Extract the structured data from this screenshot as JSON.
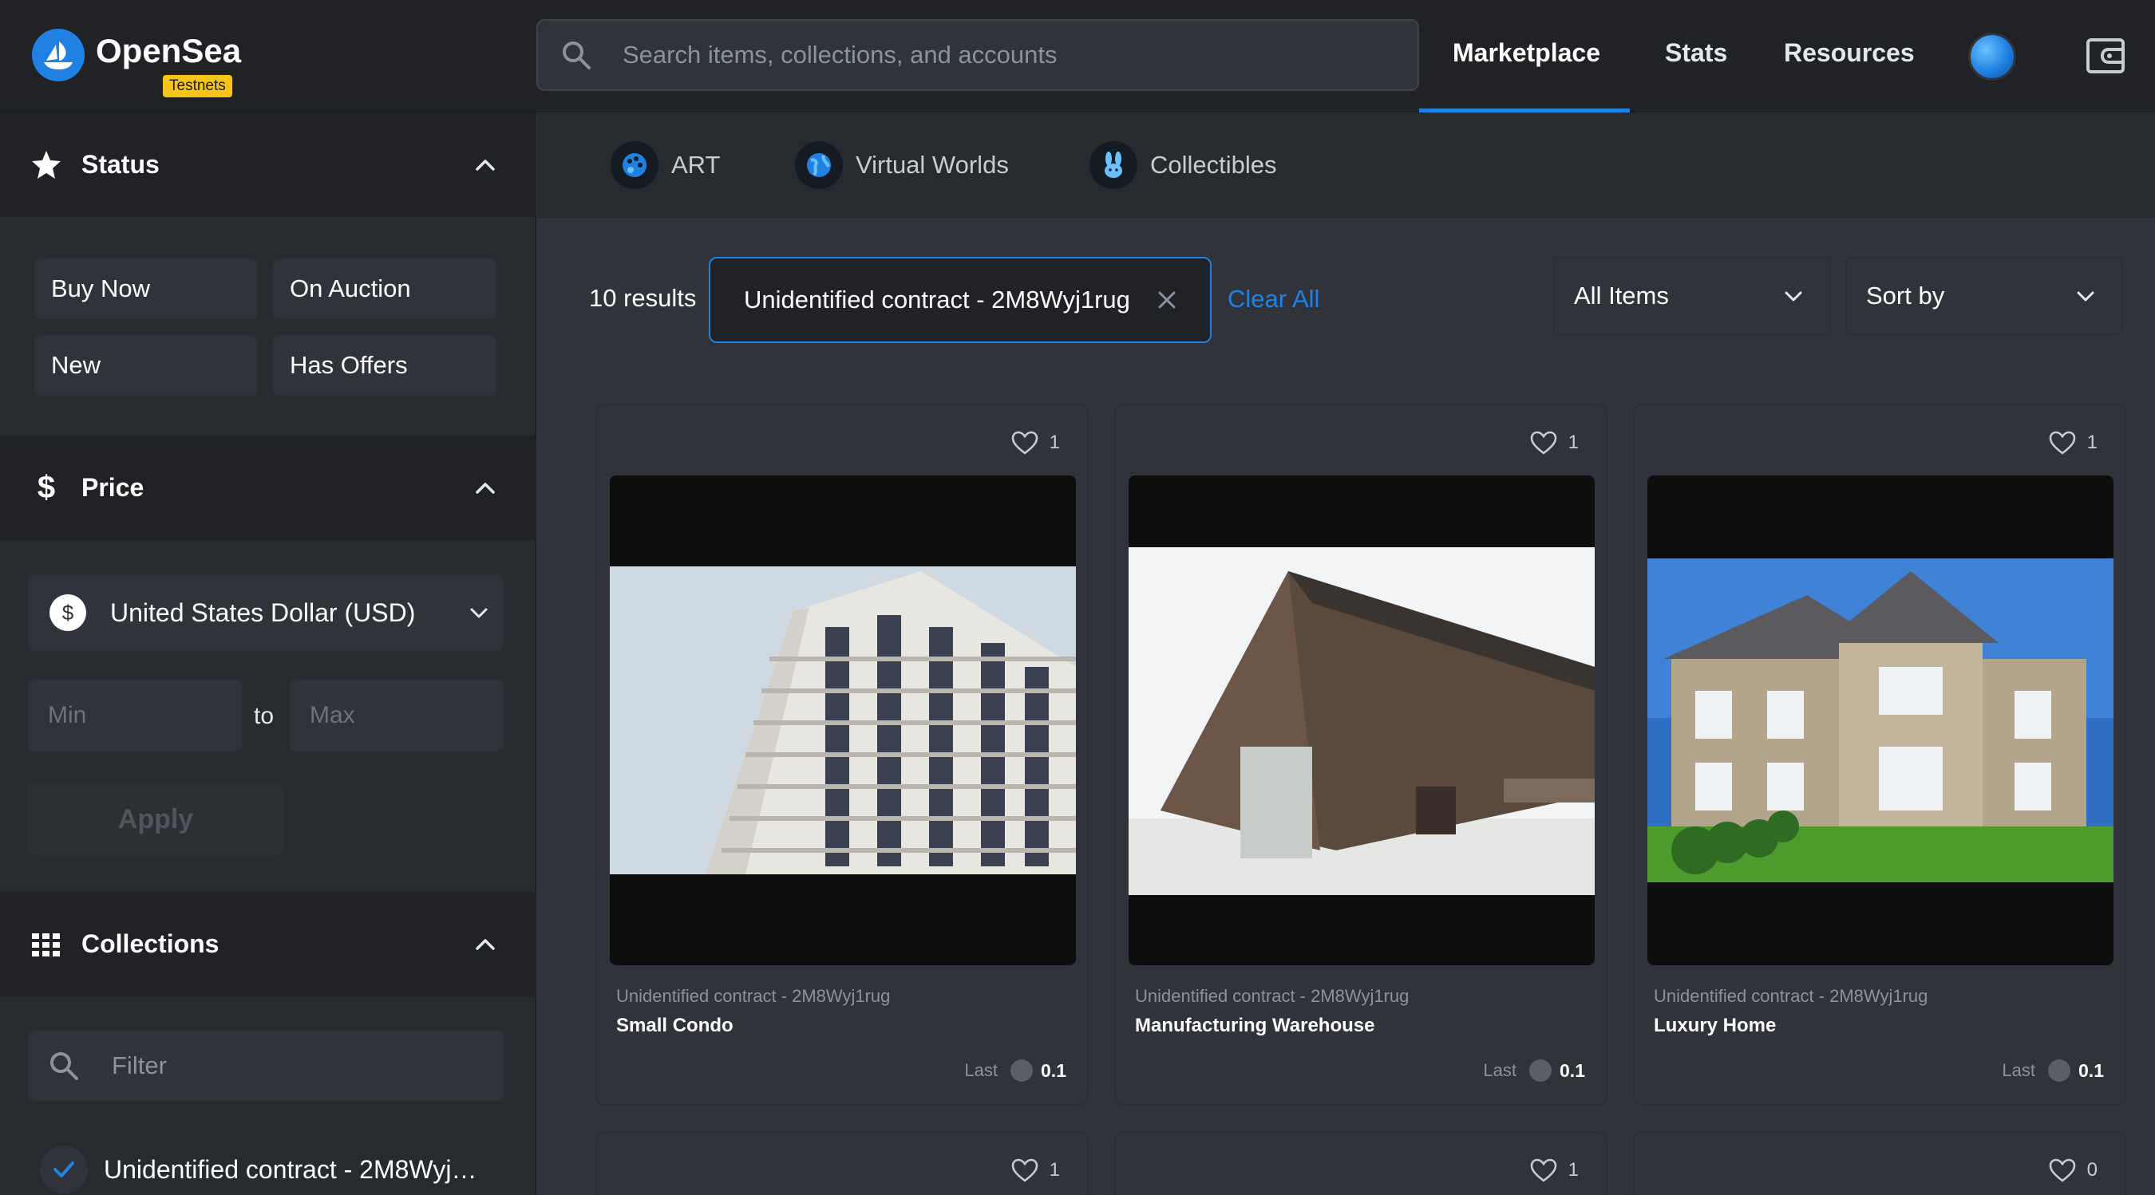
{
  "header": {
    "brand": "OpenSea",
    "badge": "Testnets",
    "search_placeholder": "Search items, collections, and accounts",
    "nav": [
      "Marketplace",
      "Stats",
      "Resources"
    ],
    "active_nav": "Marketplace",
    "accent_color": "#2081e2"
  },
  "sidebar": {
    "status": {
      "title": "Status",
      "buttons": [
        "Buy Now",
        "On Auction",
        "New",
        "Has Offers"
      ]
    },
    "price": {
      "title": "Price",
      "currency": "United States Dollar (USD)",
      "currency_symbol": "$",
      "min_placeholder": "Min",
      "to_label": "to",
      "max_placeholder": "Max",
      "apply_label": "Apply"
    },
    "collections": {
      "title": "Collections",
      "filter_placeholder": "Filter",
      "selected": "Unidentified contract - 2M8Wyj…"
    }
  },
  "categories": [
    "ART",
    "Virtual Worlds",
    "Collectibles"
  ],
  "results": {
    "count": "10 results",
    "active_filter": "Unidentified contract - 2M8Wyj1rug",
    "clear_all": "Clear All",
    "items_dropdown": "All Items",
    "sort_dropdown": "Sort by"
  },
  "cards": [
    {
      "likes": "1",
      "collection": "Unidentified contract - 2M8Wyj1rug",
      "name": "Small Condo",
      "last_label": "Last",
      "last_value": "0.1"
    },
    {
      "likes": "1",
      "collection": "Unidentified contract - 2M8Wyj1rug",
      "name": "Manufacturing Warehouse",
      "last_label": "Last",
      "last_value": "0.1"
    },
    {
      "likes": "1",
      "collection": "Unidentified contract - 2M8Wyj1rug",
      "name": "Luxury Home",
      "last_label": "Last",
      "last_value": "0.1"
    },
    {
      "likes": "1"
    },
    {
      "likes": "1"
    },
    {
      "likes": "0"
    }
  ]
}
